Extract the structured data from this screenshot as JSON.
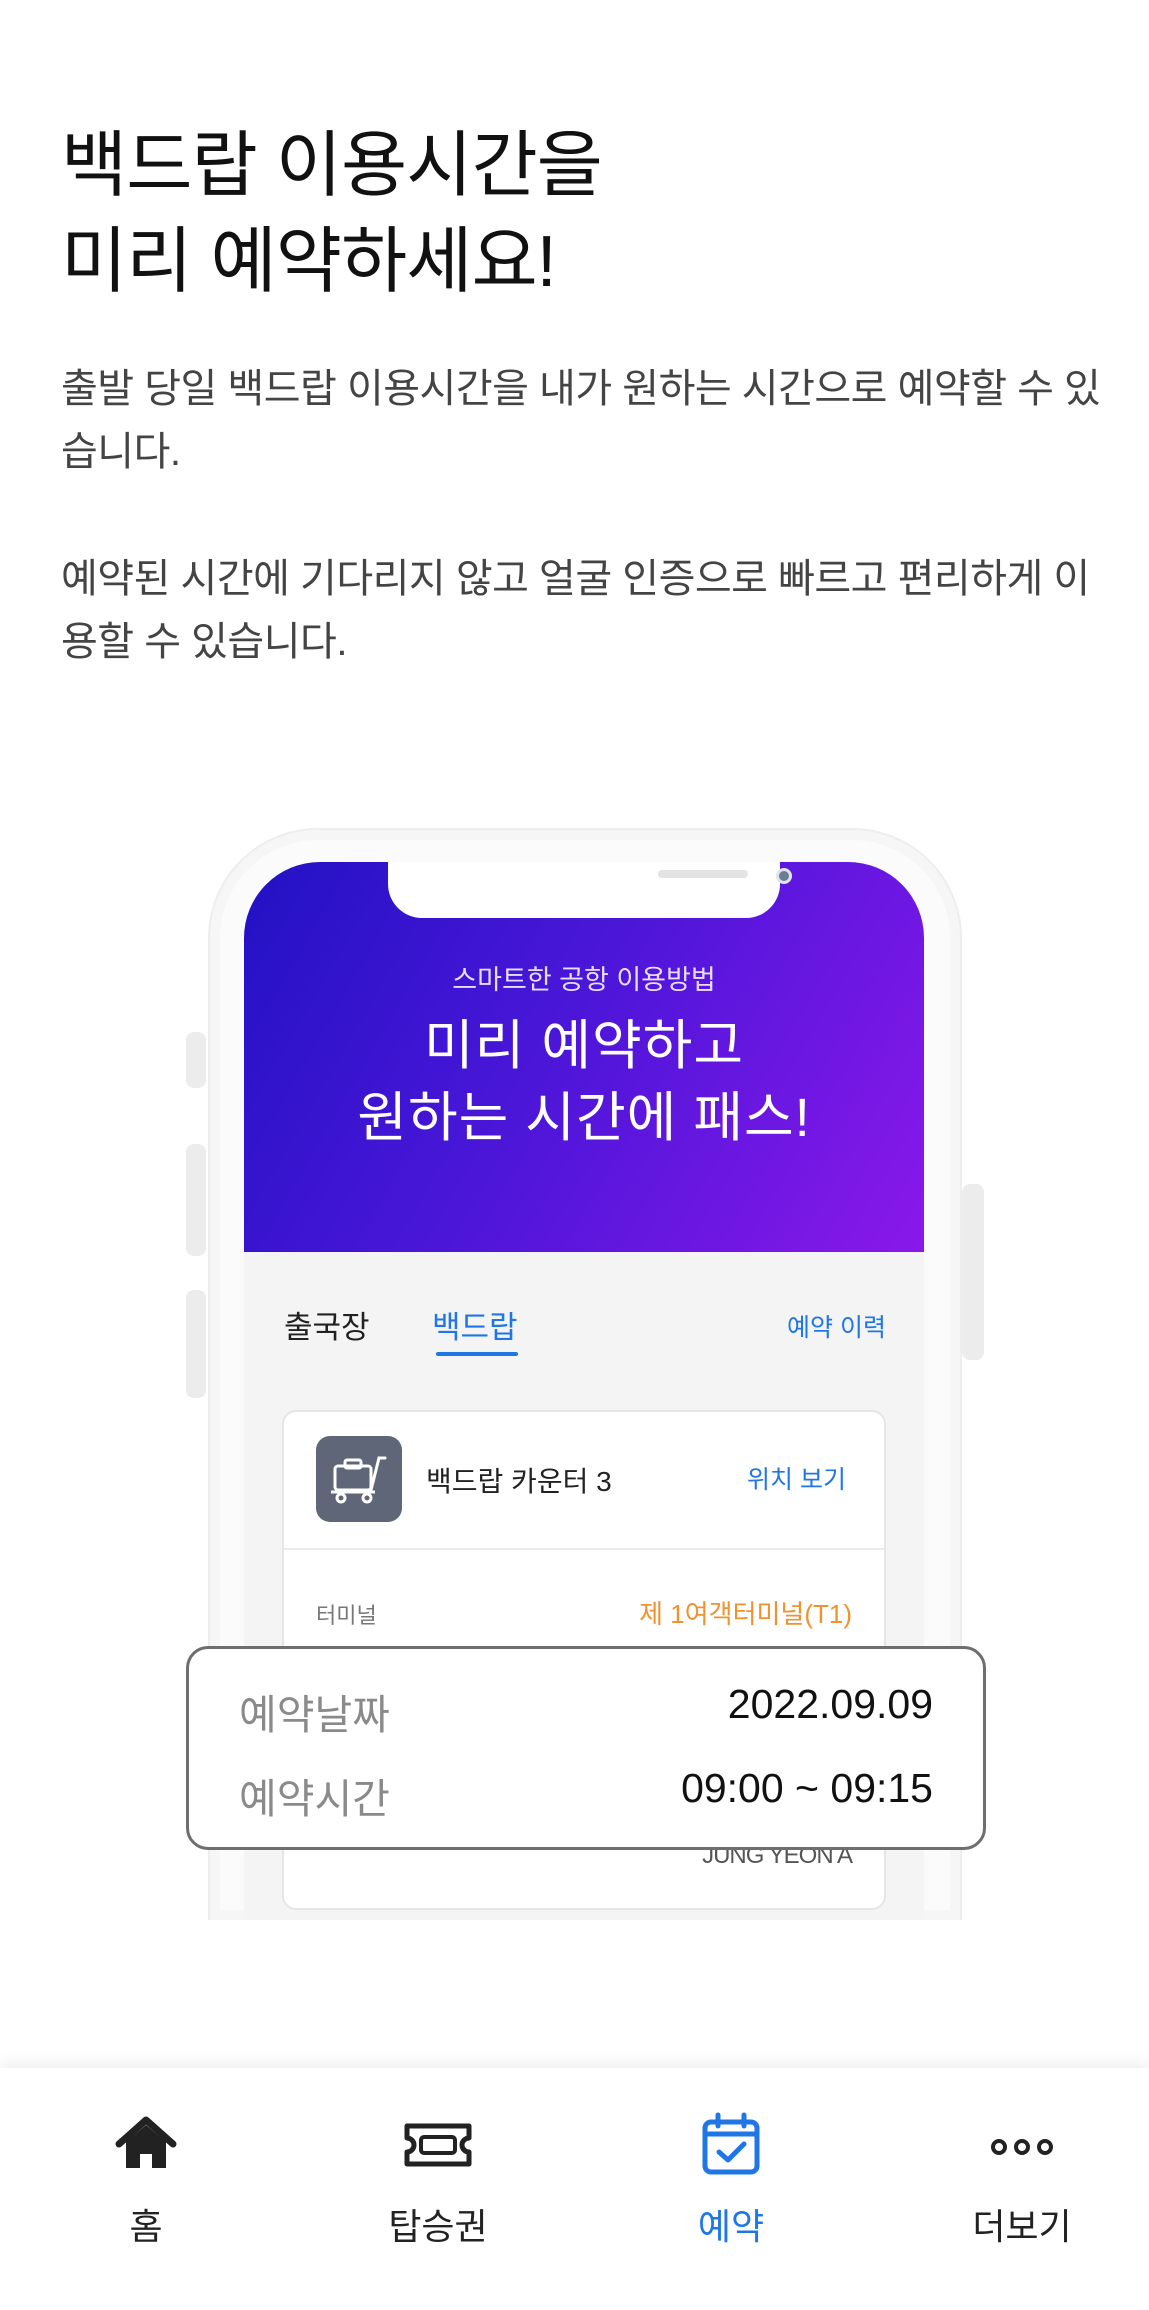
{
  "intro": {
    "title": "백드랍 이용시간을\n미리 예약하세요!",
    "paragraph1": "출발 당일 백드랍 이용시간을 내가 원하는 시간으로 예약할 수 있습니다.",
    "paragraph2": "예약된 시간에 기다리지 않고 얼굴 인증으로 빠르고 편리하게 이용할 수 있습니다."
  },
  "mockup": {
    "kicker": "스마트한 공항 이용방법",
    "title": "미리 예약하고\n원하는 시간에 패스!",
    "tabs": [
      "출국장",
      "백드랍"
    ],
    "history_link": "예약 이력",
    "counter": {
      "icon": "baggage-cart-icon",
      "title": "백드랍 카운터 3",
      "location_link": "위치 보기"
    },
    "terminal_label": "터미널",
    "terminal_value": "제 1여객터미널(T1)",
    "passenger_name": "JUNG YEON A"
  },
  "reservation": {
    "date_label": "예약날짜",
    "date_value": "2022.09.09",
    "time_label": "예약시간",
    "time_value": "09:00 ~ 09:15"
  },
  "bottom_nav": {
    "items": [
      {
        "label": "홈",
        "icon": "home-icon",
        "active": false
      },
      {
        "label": "탑승권",
        "icon": "ticket-icon",
        "active": false
      },
      {
        "label": "예약",
        "icon": "calendar-check-icon",
        "active": true
      },
      {
        "label": "더보기",
        "icon": "more-dots-icon",
        "active": false
      }
    ]
  },
  "colors": {
    "accent": "#1f76e5",
    "terminal_orange": "#ef9230",
    "gradient_start": "#2212c4",
    "gradient_end": "#8a18ea"
  }
}
